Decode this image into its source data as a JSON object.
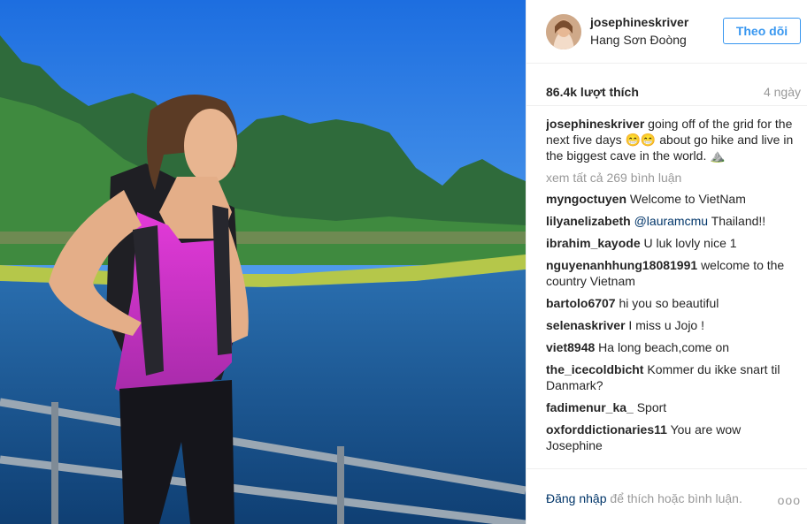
{
  "post": {
    "author": "josephineskriver",
    "location": "Hang Sơn Đoòng",
    "follow_label": "Theo dõi",
    "likes": "86.4k lượt thích",
    "time": "4 ngày",
    "caption": "going off of the grid for the next five days 😁😁 about go hike and live in the biggest cave in the world. ⛰️",
    "view_all": "xem tất cả 269 bình luận"
  },
  "comments": [
    {
      "user": "myngoctuyen",
      "text": "Welcome to VietNam"
    },
    {
      "user": "lilyanelizabeth",
      "mention": "@lauramcmu",
      "text": "Thailand!!"
    },
    {
      "user": "ibrahim_kayode",
      "text": "U luk lovly nice 1"
    },
    {
      "user": "nguyenanhhung18081991",
      "text": "welcome to the country Vietnam"
    },
    {
      "user": "bartolo6707",
      "text": "hi you so beautiful"
    },
    {
      "user": "selenaskriver",
      "text": "I miss u Jojo !"
    },
    {
      "user": "viet8948",
      "text": "Ha long beach,come on"
    },
    {
      "user": "the_icecoldbicht",
      "text": "Kommer du ikke snart til Danmark?"
    },
    {
      "user": "fadimenur_ka_",
      "text": "Sport"
    },
    {
      "user": "oxforddictionaries11",
      "text": "You are wow Josephine"
    }
  ],
  "footer": {
    "login_link": "Đăng nhập",
    "login_rest": "để thích hoặc bình luận.",
    "more": "ooo"
  },
  "colors": {
    "accent": "#3897f0",
    "link": "#003569",
    "muted": "#999999"
  }
}
